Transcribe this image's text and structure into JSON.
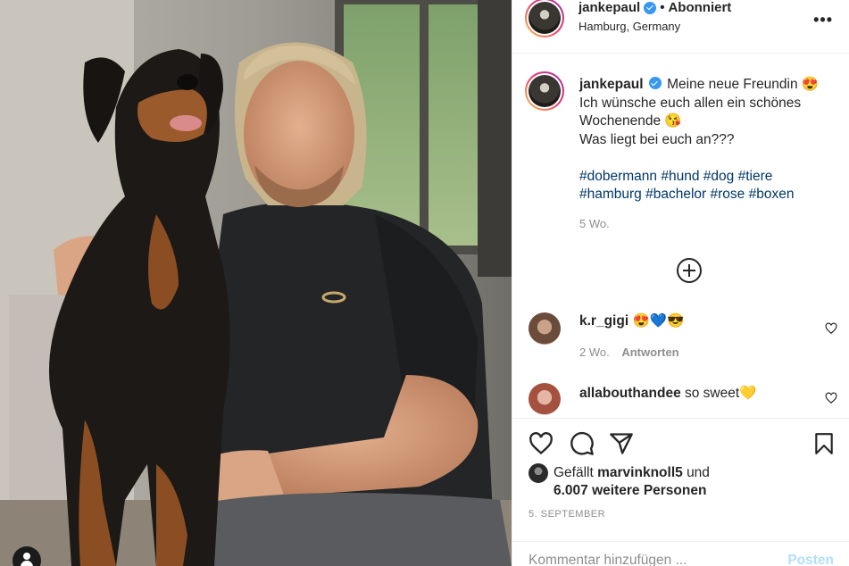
{
  "colors": {
    "accent": "#3897f0",
    "hashtag": "#00376b",
    "muted": "#8e8e8e",
    "post_disabled": "#b2dffc"
  },
  "header": {
    "username": "jankepaul",
    "separator": "•",
    "follow_state": "Abonniert",
    "location": "Hamburg, Germany",
    "more_icon": "more-horizontal-icon"
  },
  "caption": {
    "username": "jankepaul",
    "line1": "Meine neue Freundin 😍",
    "line2": "Ich wünsche euch allen ein schönes",
    "line3": "Wochenende 😘",
    "line4": "Was liegt bei euch an???",
    "hashtags_line1": [
      "#dobermann",
      "#hund",
      "#dog",
      "#tiere"
    ],
    "hashtags_line2": [
      "#hamburg",
      "#bachelor",
      "#rose",
      "#boxen"
    ],
    "time": "5 Wo."
  },
  "comments": [
    {
      "username": "k.r_gigi",
      "text": "😍💙😎",
      "time": "2 Wo.",
      "reply": "Antworten"
    },
    {
      "username": "allabouthandee",
      "text": "so sweet💛"
    }
  ],
  "likes": {
    "prefix": "Gefällt",
    "user": "marvinknoll5",
    "suffix": "und",
    "others": "6.007 weitere Personen"
  },
  "date": "5. SEPTEMBER",
  "comment_box": {
    "placeholder": "Kommentar hinzufügen ...",
    "post_label": "Posten"
  }
}
